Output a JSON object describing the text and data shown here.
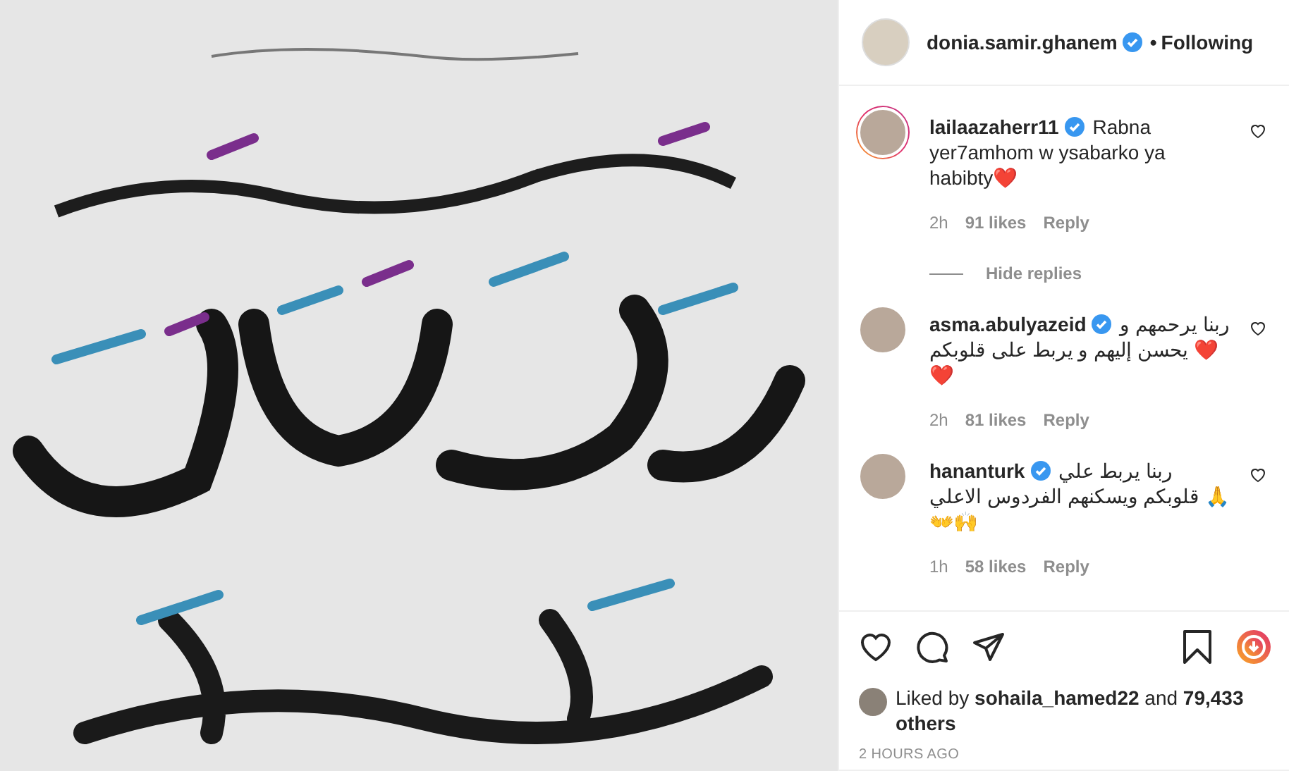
{
  "header": {
    "username": "donia.samir.ghanem",
    "verified": true,
    "separator": "•",
    "follow_label": "Following"
  },
  "comments": [
    {
      "username": "lailaazaherr11",
      "verified": true,
      "story_ring": true,
      "text": "Rabna yer7amhom w ysabarko ya habibty❤️",
      "time": "2h",
      "likes": "91 likes",
      "reply": "Reply",
      "replies_toggle": "Hide replies"
    },
    {
      "username": "asma.abulyazeid",
      "verified": true,
      "story_ring": false,
      "text": "ربنا يرحمهم و يحسن إليهم و يربط على قلوبكم ❤️❤️",
      "time": "2h",
      "likes": "81 likes",
      "reply": "Reply"
    },
    {
      "username": "hananturk",
      "verified": true,
      "story_ring": false,
      "text": "ربنا يربط علي قلوبكم ويسكنهم الفردوس الاعلي 🙏👐🙌",
      "time": "1h",
      "likes": "58 likes",
      "reply": "Reply"
    }
  ],
  "actions": {
    "liked": false,
    "saved": false
  },
  "likes_summary": "Liked by **sohaila_hamed22** and **79,433 others**",
  "timestamp": "2 HOURS AGO"
}
